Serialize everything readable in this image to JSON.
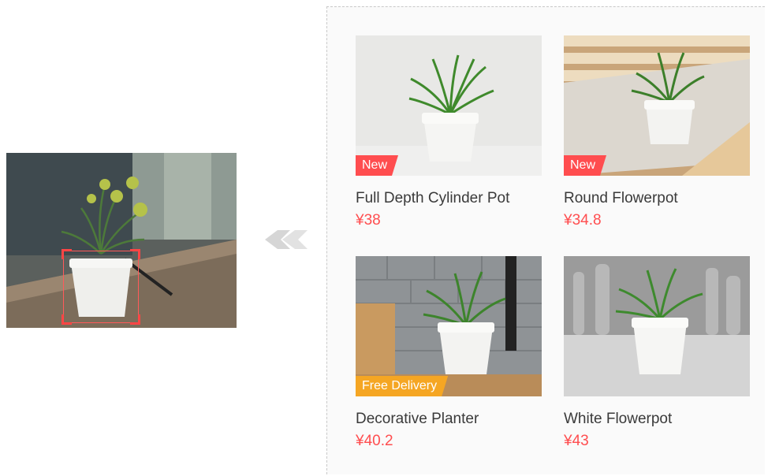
{
  "query": {
    "image": "potted-grass-plant-on-tv-stand",
    "highlight_color": "#ff4d4f"
  },
  "arrow_icon": "right-arrow-icon",
  "results": {
    "products": [
      {
        "title": "Full Depth Cylinder Pot",
        "price": "¥38",
        "badge": "New",
        "badge_color": "#ff4d4f"
      },
      {
        "title": "Round Flowerpot",
        "price": "¥34.8",
        "badge": "New",
        "badge_color": "#ff4d4f"
      },
      {
        "title": "Decorative Planter",
        "price": "¥40.2",
        "badge": "Free Delivery",
        "badge_color": "#f5a623"
      },
      {
        "title": "White Flowerpot",
        "price": "¥43",
        "badge": "",
        "badge_color": ""
      }
    ]
  }
}
